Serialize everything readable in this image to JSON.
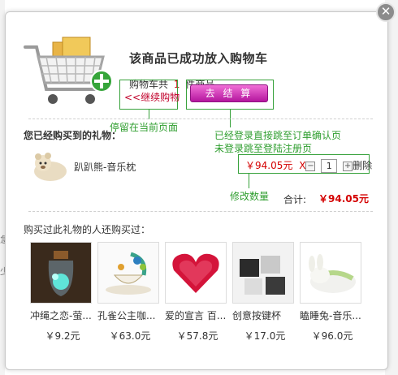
{
  "background": {
    "left_chars": [
      "急",
      "少"
    ]
  },
  "dialog": {
    "close_glyph": "✕",
    "title": "该商品已成功放入购物车",
    "cart_count_prefix": "购物车共",
    "cart_count_num": "1",
    "cart_count_suffix": "件商品",
    "continue_label": "<<继续购物",
    "checkout_label": "去 结 算",
    "bought_title": "您已经购买到的礼物：",
    "item": {
      "name": "趴趴熊-音乐枕",
      "price": "￥94.05元",
      "remove_x": "X",
      "minus": "⊟",
      "qty": "1",
      "plus": "⊞",
      "delete_label": "删除"
    },
    "total_label": "合计:",
    "total_value": "￥94.05元",
    "also_bought_title": "购买过此礼物的人还购买过：",
    "products": [
      {
        "name": "冲绳之恋-萤...",
        "price": "￥9.2元"
      },
      {
        "name": "孔雀公主咖...",
        "price": "￥63.0元"
      },
      {
        "name": "爱的宣言 百...",
        "price": "￥57.8元"
      },
      {
        "name": "创意按键杯",
        "price": "￥17.0元"
      },
      {
        "name": "瞌睡兔-音乐...",
        "price": "￥96.0元"
      }
    ]
  },
  "annotations": {
    "stay_page": "停留在当前页面",
    "logged_in": "已经登录直接跳至订单确认页",
    "not_logged_in": "未登录跳至登陆注册页",
    "modify_qty": "修改数量"
  },
  "colors": {
    "annotation_green": "#36a13a",
    "price_red": "#d40000",
    "checkout_magenta": "#d03cbb"
  }
}
